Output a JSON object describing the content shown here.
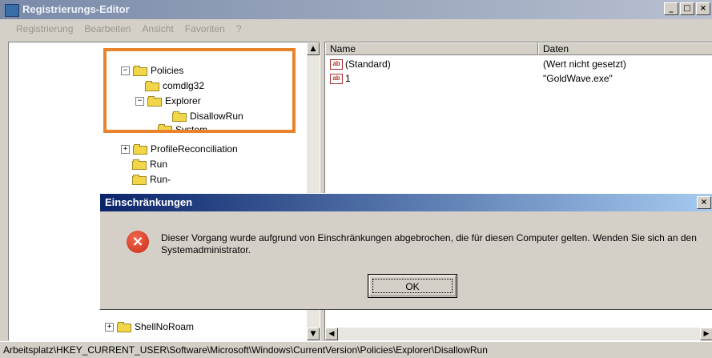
{
  "window": {
    "title": "Registrierungs-Editor",
    "controls": [
      "_",
      "□",
      "×"
    ]
  },
  "menu": [
    "Registrierung",
    "Bearbeiten",
    "Ansicht",
    "Favoriten",
    "?"
  ],
  "tree": {
    "items": [
      {
        "label": "Policies",
        "expander": "−"
      },
      {
        "label": "comdlg32",
        "expander": ""
      },
      {
        "label": "Explorer",
        "expander": "−"
      },
      {
        "label": "DisallowRun",
        "expander": ""
      },
      {
        "label": "System",
        "expander": ""
      },
      {
        "label": "ProfileReconciliation",
        "expander": "+"
      },
      {
        "label": "Run",
        "expander": ""
      },
      {
        "label": "Run-",
        "expander": ""
      },
      {
        "label": "ShellNoRoam",
        "expander": "+"
      }
    ]
  },
  "list": {
    "columns": [
      "Name",
      "Daten"
    ],
    "rows": [
      {
        "name": "(Standard)",
        "data": "(Wert nicht gesetzt)"
      },
      {
        "name": "1",
        "data": "\"GoldWave.exe\""
      }
    ]
  },
  "status": "Arbeitsplatz\\HKEY_CURRENT_USER\\Software\\Microsoft\\Windows\\CurrentVersion\\Policies\\Explorer\\DisallowRun",
  "dialog": {
    "title": "Einschränkungen",
    "message": "Dieser Vorgang wurde aufgrund von Einschränkungen abgebrochen, die für diesen Computer gelten. Wenden Sie sich an den Systemadministrator.",
    "ok_label": "OK",
    "icon": "error-icon"
  },
  "colors": {
    "highlight": "#e9832b",
    "dialog_title": "#0a246a"
  }
}
